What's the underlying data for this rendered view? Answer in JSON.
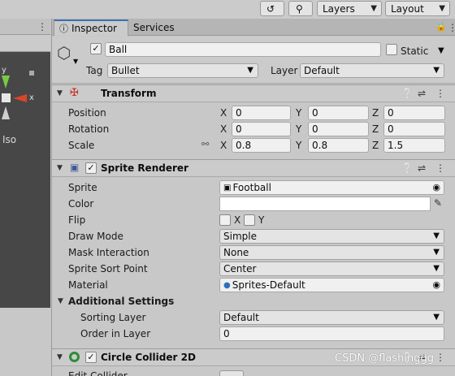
{
  "toolbar": {
    "history_icon": "history-icon",
    "search_icon": "search-icon",
    "layers_label": "Layers",
    "layout_label": "Layout"
  },
  "scene": {
    "axis_y": "y",
    "axis_x": "x",
    "iso_label": "Iso",
    "colors": {
      "y_axis": "#7ac943",
      "x_axis": "#d9442b"
    }
  },
  "inspector": {
    "tabs": [
      {
        "label": "Inspector"
      },
      {
        "label": "Services"
      }
    ],
    "object": {
      "name": "Ball",
      "static_label": "Static",
      "tag_label": "Tag",
      "tag_value": "Bullet",
      "layer_label": "Layer",
      "layer_value": "Default"
    },
    "transform": {
      "title": "Transform",
      "rows": [
        {
          "label": "Position",
          "x": "0",
          "y": "0",
          "z": "0"
        },
        {
          "label": "Rotation",
          "x": "0",
          "y": "0",
          "z": "0"
        },
        {
          "label": "Scale",
          "x": "0.8",
          "y": "0.8",
          "z": "1.5"
        }
      ],
      "axis_labels": {
        "x": "X",
        "y": "Y",
        "z": "Z"
      }
    },
    "sprite_renderer": {
      "title": "Sprite Renderer",
      "sprite_label": "Sprite",
      "sprite_value": "Football",
      "color_label": "Color",
      "color_value": "#ffffff",
      "flip_label": "Flip",
      "flip_x": "X",
      "flip_y": "Y",
      "draw_mode_label": "Draw Mode",
      "draw_mode_value": "Simple",
      "mask_label": "Mask Interaction",
      "mask_value": "None",
      "sort_point_label": "Sprite Sort Point",
      "sort_point_value": "Center",
      "material_label": "Material",
      "material_value": "Sprites-Default",
      "additional_label": "Additional Settings",
      "sorting_layer_label": "Sorting Layer",
      "sorting_layer_value": "Default",
      "order_label": "Order in Layer",
      "order_value": "0"
    },
    "circle_collider": {
      "title": "Circle Collider 2D",
      "edit_label": "Edit Collider"
    },
    "accent": "#3a72b0"
  },
  "watermark": "CSDN @flashinggg"
}
